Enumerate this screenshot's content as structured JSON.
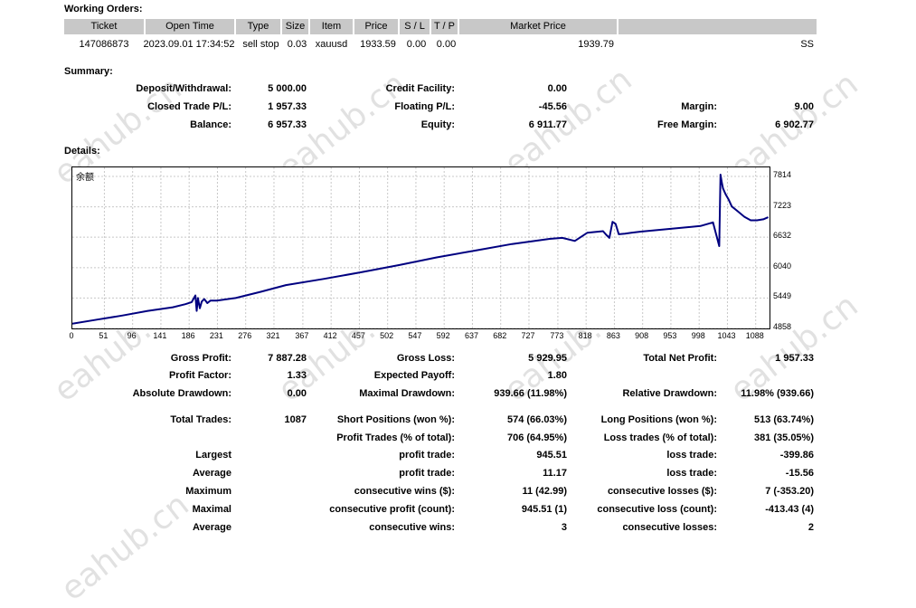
{
  "working_orders": {
    "title": "Working Orders:",
    "headers": [
      "Ticket",
      "Open Time",
      "Type",
      "Size",
      "Item",
      "Price",
      "S / L",
      "T / P",
      "Market Price",
      ""
    ],
    "row": [
      "147086873",
      "2023.09.01 17:34:52",
      "sell stop",
      "0.03",
      "xauusd",
      "1933.59",
      "0.00",
      "0.00",
      "1939.79",
      "SS"
    ]
  },
  "summary": {
    "title": "Summary:",
    "deposit_label": "Deposit/Withdrawal:",
    "deposit_value": "5 000.00",
    "credit_label": "Credit Facility:",
    "credit_value": "0.00",
    "closed_label": "Closed Trade P/L:",
    "closed_value": "1 957.33",
    "floating_label": "Floating P/L:",
    "floating_value": "-45.56",
    "margin_label": "Margin:",
    "margin_value": "9.00",
    "balance_label": "Balance:",
    "balance_value": "6 957.33",
    "equity_label": "Equity:",
    "equity_value": "6 911.77",
    "free_margin_label": "Free Margin:",
    "free_margin_value": "6 902.77"
  },
  "details": {
    "title": "Details:"
  },
  "chart_data": {
    "type": "line",
    "title": "余额",
    "x_ticks": [
      "0",
      "51",
      "96",
      "141",
      "186",
      "231",
      "276",
      "321",
      "367",
      "412",
      "457",
      "502",
      "547",
      "592",
      "637",
      "682",
      "727",
      "773",
      "818",
      "863",
      "908",
      "953",
      "998",
      "1043",
      "1088"
    ],
    "y_ticks": [
      "7814",
      "7223",
      "6632",
      "6040",
      "5449",
      "4858"
    ],
    "xlim": [
      0,
      1110
    ],
    "ylim": [
      4858,
      7990
    ],
    "grid": true,
    "color": "#000080",
    "series": [
      {
        "x": [
          0,
          40,
          80,
          120,
          160,
          180,
          190,
          196,
          198,
          200,
          203,
          206,
          210,
          215,
          220,
          230,
          260,
          300,
          340,
          400,
          460,
          520,
          580,
          640,
          700,
          760,
          780,
          800,
          820,
          845,
          850,
          855,
          860,
          865,
          870,
          880,
          890,
          905,
          1000,
          1020,
          1030,
          1032,
          1034,
          1036,
          1040,
          1045,
          1050,
          1060,
          1070,
          1080,
          1090,
          1100,
          1108
        ],
        "y": [
          4950,
          5030,
          5110,
          5200,
          5270,
          5330,
          5370,
          5500,
          5200,
          5450,
          5250,
          5380,
          5430,
          5350,
          5400,
          5400,
          5450,
          5570,
          5700,
          5820,
          5950,
          6090,
          6240,
          6370,
          6500,
          6600,
          6620,
          6560,
          6720,
          6750,
          6680,
          6620,
          6930,
          6890,
          6690,
          6700,
          6720,
          6740,
          6850,
          6920,
          6460,
          7850,
          7700,
          7580,
          7470,
          7360,
          7230,
          7130,
          7030,
          6960,
          6960,
          6980,
          7020
        ]
      }
    ]
  },
  "stats": {
    "gross_profit_label": "Gross Profit:",
    "gross_profit_value": "7 887.28",
    "gross_loss_label": "Gross Loss:",
    "gross_loss_value": "5 929.95",
    "total_net_label": "Total Net Profit:",
    "total_net_value": "1 957.33",
    "profit_factor_label": "Profit Factor:",
    "profit_factor_value": "1.33",
    "expected_payoff_label": "Expected Payoff:",
    "expected_payoff_value": "1.80",
    "abs_dd_label": "Absolute Drawdown:",
    "abs_dd_value": "0.00",
    "max_dd_label": "Maximal Drawdown:",
    "max_dd_value": "939.66 (11.98%)",
    "rel_dd_label": "Relative Drawdown:",
    "rel_dd_value": "11.98% (939.66)",
    "total_trades_label": "Total Trades:",
    "total_trades_value": "1087",
    "short_label": "Short Positions (won %):",
    "short_value": "574 (66.03%)",
    "long_label": "Long Positions (won %):",
    "long_value": "513 (63.74%)",
    "profit_trades_label": "Profit Trades (% of total):",
    "profit_trades_value": "706 (64.95%)",
    "loss_trades_label": "Loss trades (% of total):",
    "loss_trades_value": "381 (35.05%)",
    "largest_label": "Largest",
    "largest_profit_label": "profit trade:",
    "largest_profit_value": "945.51",
    "largest_loss_label": "loss trade:",
    "largest_loss_value": "-399.86",
    "average_label": "Average",
    "avg_profit_label": "profit trade:",
    "avg_profit_value": "11.17",
    "avg_loss_label": "loss trade:",
    "avg_loss_value": "-15.56",
    "maximum_label": "Maximum",
    "max_cons_wins_label": "consecutive wins ($):",
    "max_cons_wins_value": "11 (42.99)",
    "max_cons_losses_label": "consecutive losses ($):",
    "max_cons_losses_value": "7 (-353.20)",
    "maximal_label": "Maximal",
    "maximal_profit_label": "consecutive profit (count):",
    "maximal_profit_value": "945.51 (1)",
    "maximal_loss_label": "consecutive loss (count):",
    "maximal_loss_value": "-413.43 (4)",
    "average2_label": "Average",
    "avg_cons_wins_label": "consecutive wins:",
    "avg_cons_wins_value": "3",
    "avg_cons_losses_label": "consecutive losses:",
    "avg_cons_losses_value": "2"
  },
  "watermark": "eahub.cn"
}
